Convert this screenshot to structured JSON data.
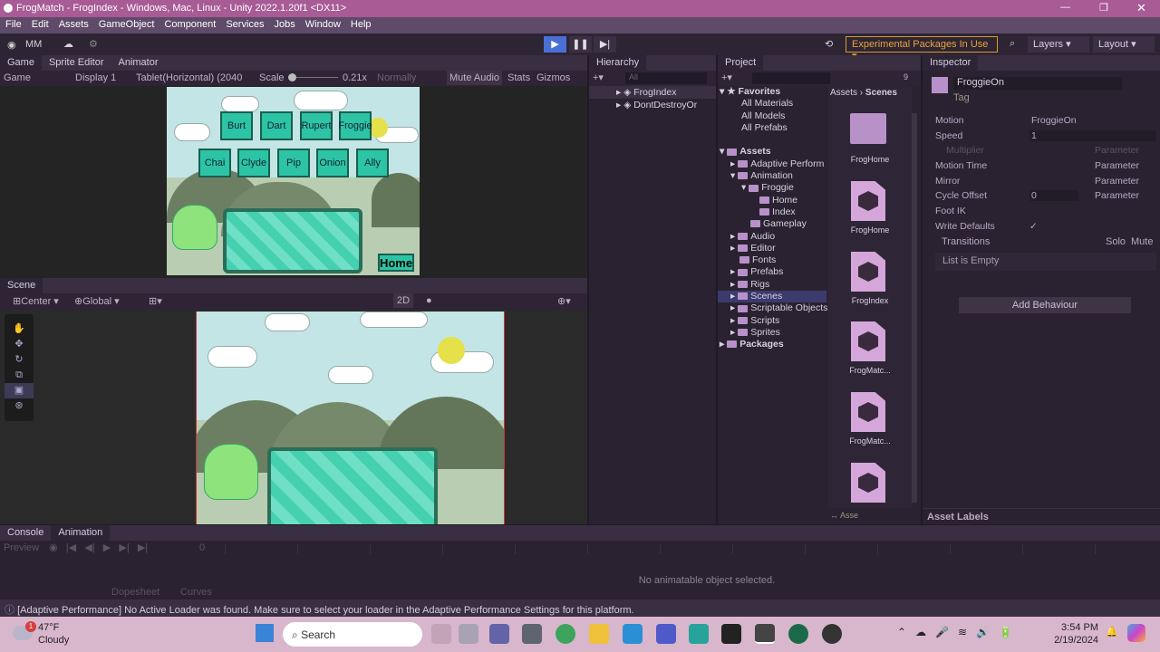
{
  "window": {
    "title": "FrogMatch - FrogIndex - Windows, Mac, Linux - Unity 2022.1.20f1 <DX11>"
  },
  "menu": [
    "File",
    "Edit",
    "Assets",
    "GameObject",
    "Component",
    "Services",
    "Jobs",
    "Window",
    "Help"
  ],
  "toolbar": {
    "account": "MM",
    "packages_label": "Experimental Packages In Use",
    "layers": "Layers",
    "layout": "Layout"
  },
  "game": {
    "tabs": [
      "Game",
      "Sprite Editor",
      "Animator"
    ],
    "view": "Game",
    "display": "Display 1",
    "resolution": "Tablet(Horizontal) (2040",
    "scale_label": "Scale",
    "scale_value": "0.21x",
    "quality": "Normally",
    "mute": "Mute Audio",
    "stats": "Stats",
    "gizmos": "Gizmos",
    "buttons_row1": [
      "Burt",
      "Dart",
      "Rupert",
      "Froggie"
    ],
    "buttons_row2": [
      "Chai",
      "Clyde",
      "Pip",
      "Onion",
      "Ally"
    ],
    "home_button": "Home"
  },
  "scene": {
    "tab": "Scene",
    "pivot": "Center",
    "space": "Global",
    "mode2d": "2D"
  },
  "hierarchy": {
    "title": "Hierarchy",
    "search": "All",
    "items": [
      "FrogIndex",
      "DontDestroyOr"
    ]
  },
  "project": {
    "title": "Project",
    "favorites_title": "Favorites",
    "favorites": [
      "All Materials",
      "All Models",
      "All Prefabs"
    ],
    "assets_title": "Assets",
    "folders": [
      "Adaptive Perform",
      "Animation",
      "Froggie",
      "Home",
      "Index",
      "Gameplay",
      "Audio",
      "Editor",
      "Fonts",
      "Prefabs",
      "Rigs",
      "Scenes",
      "Scriptable Objects",
      "Scripts",
      "Sprites"
    ],
    "packages": "Packages",
    "breadcrumb": [
      "Assets",
      "Scenes"
    ],
    "files": [
      "FrogHome",
      "FrogHome",
      "FrogIndex",
      "FrogMatc...",
      "FrogMatc...",
      ""
    ],
    "footer": "Asse",
    "count": "9"
  },
  "inspector": {
    "title": "Inspector",
    "name": "FroggieOn",
    "tag_label": "Tag",
    "rows": [
      {
        "label": "Motion",
        "value": "FroggieOn"
      },
      {
        "label": "Speed",
        "value": "1"
      },
      {
        "label": "Multiplier",
        "value": ""
      },
      {
        "label": "Motion Time",
        "value": ""
      },
      {
        "label": "Mirror",
        "value": ""
      },
      {
        "label": "Cycle Offset",
        "value": "0"
      },
      {
        "label": "Foot IK",
        "value": ""
      },
      {
        "label": "Write Defaults",
        "value": "✓"
      }
    ],
    "param": "Parameter",
    "transitions": "Transitions",
    "solo": "Solo",
    "mute": "Mute",
    "list_empty": "List is Empty",
    "add_behaviour": "Add Behaviour",
    "asset_labels": "Asset Labels"
  },
  "bottom": {
    "tabs": [
      "Console",
      "Animation"
    ],
    "preview": "Preview",
    "frame": "0",
    "no_object": "No animatable object selected.",
    "dopesheet": "Dopesheet",
    "curves": "Curves"
  },
  "status": {
    "message": "[Adaptive Performance] No Active Loader was found. Make sure to select your loader in the Adaptive Performance Settings for this platform."
  },
  "taskbar": {
    "temp": "47°F",
    "weather": "Cloudy",
    "search": "Search",
    "time": "3:54 PM",
    "date": "2/19/2024",
    "badge": "1"
  }
}
